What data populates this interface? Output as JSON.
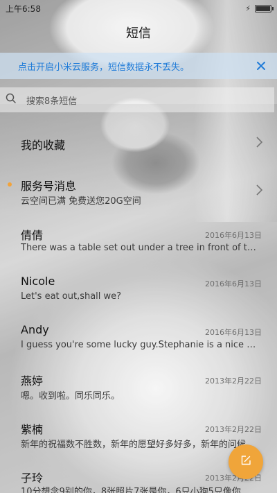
{
  "status_bar": {
    "time": "上午6:58"
  },
  "header": {
    "title": "短信"
  },
  "cloud_banner": {
    "text": "点击开启小米云服务，短信数据永不丢失。"
  },
  "search": {
    "placeholder": "搜索8条短信"
  },
  "colors": {
    "accent_blue": "#1f7bd8",
    "fab_orange": "#f0a53a",
    "unread_dot": "#f2a33a"
  },
  "favorites": {
    "label": "我的收藏"
  },
  "service": {
    "name": "服务号消息",
    "preview": "云空间已满 免费送您20G空间"
  },
  "conversations": [
    {
      "name": "倩倩",
      "date": "2016年6月13日",
      "preview": "There was a table set out under a tree in front of the ho..."
    },
    {
      "name": "Nicole",
      "date": "2016年6月13日",
      "preview": "Let's eat out,shall we?"
    },
    {
      "name": "Andy",
      "date": "2016年6月13日",
      "preview": "I guess you're some lucky guy.Stephanie is a nice girl."
    },
    {
      "name": "燕婷",
      "date": "2013年2月22日",
      "preview": "嗯。收到啦。同乐同乐。"
    },
    {
      "name": "紫楠",
      "date": "2013年2月22日",
      "preview": "新年的祝福数不胜数，新年的愿望好多好多，新年的问候..."
    },
    {
      "name": "子玲",
      "date": "2013年2月22日",
      "preview": "10分想念9别的你，8张照片7张是你，6只小狗5只像你，4..."
    }
  ],
  "icons": {
    "search": "search-icon",
    "close": "close-icon",
    "chevron": "chevron-right-icon",
    "compose": "compose-icon",
    "battery": "battery-icon",
    "charging": "charging-icon"
  }
}
